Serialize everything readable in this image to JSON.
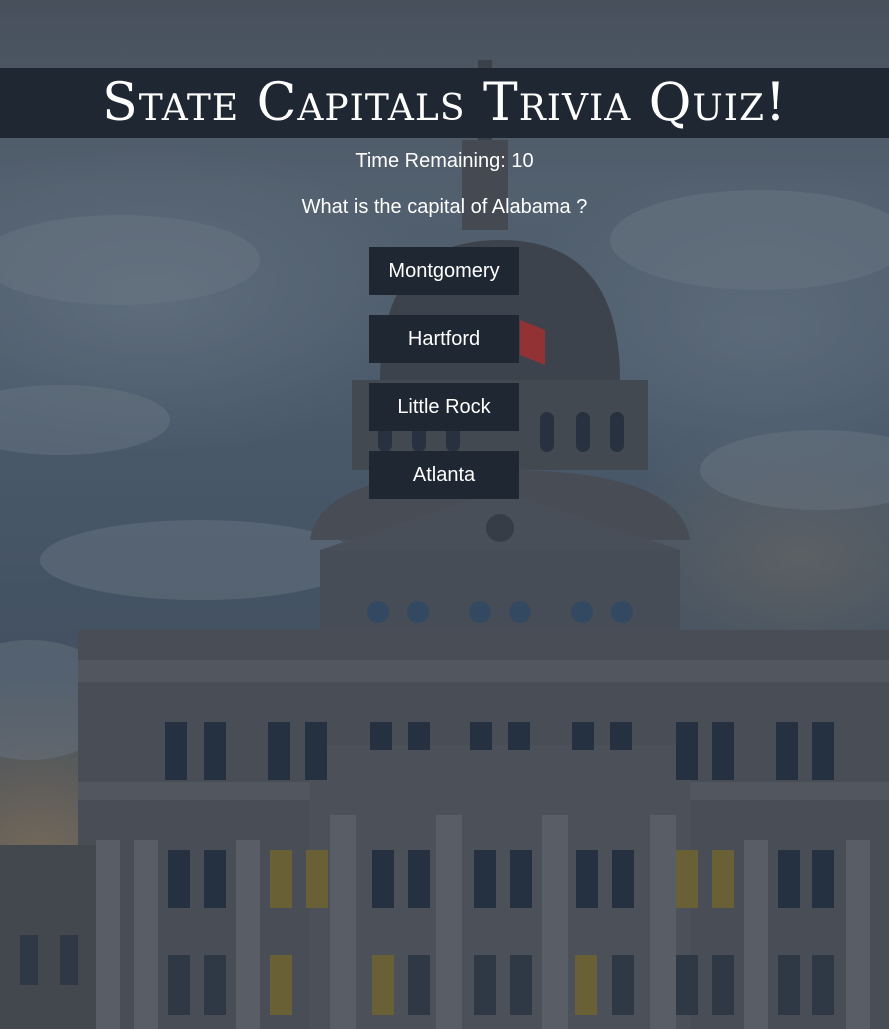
{
  "background": {
    "image": "capitol-building-photo",
    "overlay_color": "#141c26"
  },
  "header": {
    "title": "State Capitals Trivia Quiz!",
    "bar_color": "#1f2733"
  },
  "quiz": {
    "timer_text": "Time Remaining: 10",
    "question": "What is the capital of Alabama ?",
    "answers": [
      {
        "label": "Montgomery"
      },
      {
        "label": "Hartford"
      },
      {
        "label": "Little Rock"
      },
      {
        "label": "Atlanta"
      }
    ],
    "button_color": "#1f2733"
  }
}
